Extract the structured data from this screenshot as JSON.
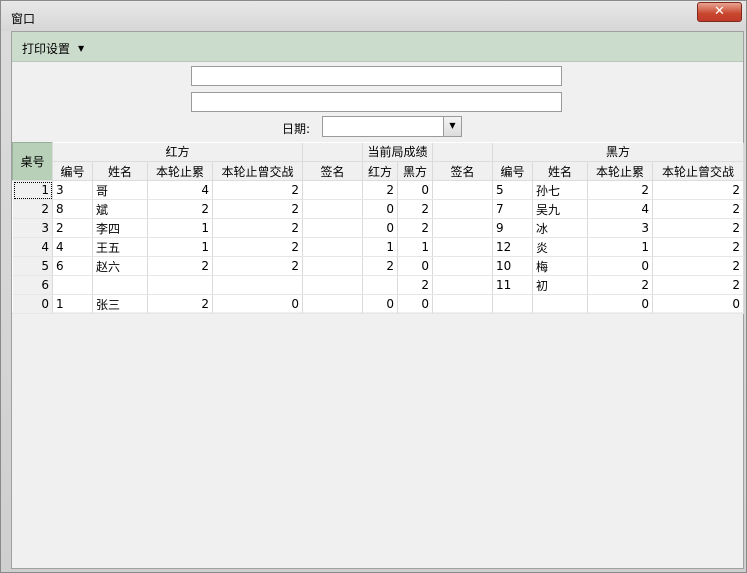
{
  "window": {
    "title": "窗口",
    "close_icon": "✕"
  },
  "toolbar": {
    "print_label": "打印设置"
  },
  "form": {
    "date_label": "日期:"
  },
  "grid": {
    "corner": "桌号",
    "groups": {
      "red": "红方",
      "current": "当前局成绩",
      "black": "黑方"
    },
    "columns": {
      "red_no": "编号",
      "red_name": "姓名",
      "red_cum": "本轮止累",
      "red_played": "本轮止曾交战",
      "red_sign": "签名",
      "score_red": "红方",
      "score_black": "黑方",
      "black_sign": "签名",
      "black_no": "编号",
      "black_name": "姓名",
      "black_cum": "本轮止累",
      "black_played": "本轮止曾交战"
    },
    "rows": [
      {
        "table": "1",
        "rno": "3",
        "rname": "哥",
        "rcum": "4",
        "rplayed": "2",
        "rsign": "",
        "sred": "2",
        "sblack": "0",
        "bsign": "",
        "bno": "5",
        "bname": "孙七",
        "bcum": "2",
        "bplayed": "2"
      },
      {
        "table": "2",
        "rno": "8",
        "rname": "斌",
        "rcum": "2",
        "rplayed": "2",
        "rsign": "",
        "sred": "0",
        "sblack": "2",
        "bsign": "",
        "bno": "7",
        "bname": "吴九",
        "bcum": "4",
        "bplayed": "2"
      },
      {
        "table": "3",
        "rno": "2",
        "rname": "李四",
        "rcum": "1",
        "rplayed": "2",
        "rsign": "",
        "sred": "0",
        "sblack": "2",
        "bsign": "",
        "bno": "9",
        "bname": "冰",
        "bcum": "3",
        "bplayed": "2"
      },
      {
        "table": "4",
        "rno": "4",
        "rname": "王五",
        "rcum": "1",
        "rplayed": "2",
        "rsign": "",
        "sred": "1",
        "sblack": "1",
        "bsign": "",
        "bno": "12",
        "bname": "炎",
        "bcum": "1",
        "bplayed": "2"
      },
      {
        "table": "5",
        "rno": "6",
        "rname": "赵六",
        "rcum": "2",
        "rplayed": "2",
        "rsign": "",
        "sred": "2",
        "sblack": "0",
        "bsign": "",
        "bno": "10",
        "bname": "梅",
        "bcum": "0",
        "bplayed": "2"
      },
      {
        "table": "6",
        "rno": "",
        "rname": "",
        "rcum": "",
        "rplayed": "",
        "rsign": "",
        "sred": "",
        "sblack": "2",
        "bsign": "",
        "bno": "11",
        "bname": "初",
        "bcum": "2",
        "bplayed": "2"
      },
      {
        "table": "0",
        "rno": "1",
        "rname": "张三",
        "rcum": "2",
        "rplayed": "0",
        "rsign": "",
        "sred": "0",
        "sblack": "0",
        "bsign": "",
        "bno": "",
        "bname": "",
        "bcum": "0",
        "bplayed": "0"
      }
    ]
  }
}
